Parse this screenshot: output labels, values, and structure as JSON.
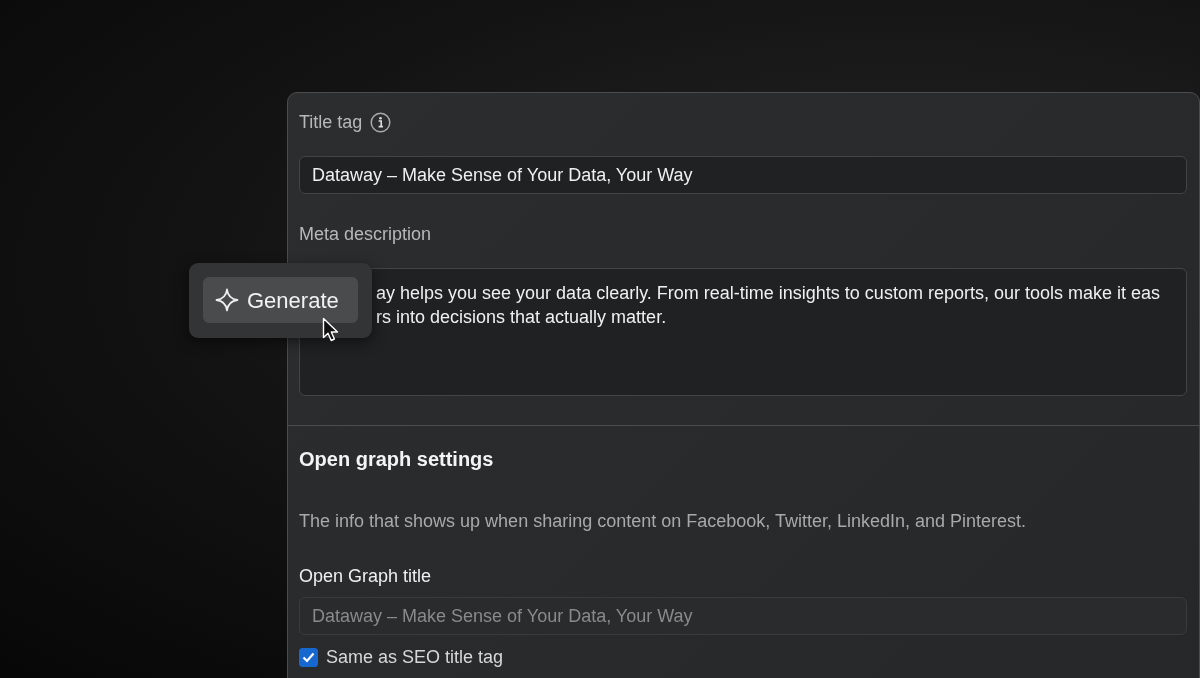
{
  "title_tag": {
    "label": "Title tag",
    "value": "Dataway – Make Sense of Your Data, Your Way"
  },
  "meta_description": {
    "label": "Meta description",
    "lines": [
      "ay helps you see your data clearly. From real-time insights to custom reports, our tools make it eas",
      "rs into decisions that actually matter."
    ]
  },
  "generate_popover": {
    "button": "Generate"
  },
  "open_graph": {
    "heading": "Open graph settings",
    "description": "The info that shows up when sharing content on Facebook, Twitter, LinkedIn, and Pinterest.",
    "title_label": "Open Graph title",
    "title_field": {
      "value": "Dataway – Make Sense of Your Data, Your Way",
      "disabled": true
    },
    "same_as_seo": {
      "label": "Same as SEO title tag",
      "checked": true
    }
  }
}
